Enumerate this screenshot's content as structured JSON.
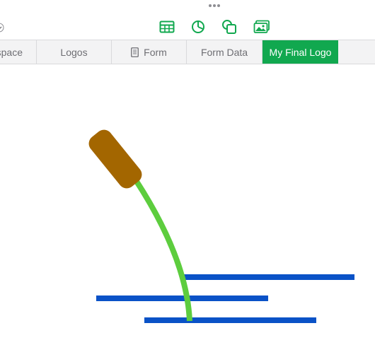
{
  "toolbar": {
    "icons": [
      "more-dots-icon",
      "table-icon",
      "chart-icon",
      "shape-icon",
      "media-icon"
    ],
    "accent_color": "#11a84f"
  },
  "tabs": [
    {
      "label": "space",
      "active": false
    },
    {
      "label": "Logos",
      "active": false
    },
    {
      "label": "Form",
      "active": false,
      "icon": "document-icon"
    },
    {
      "label": "Form Data",
      "active": false
    },
    {
      "label": "My Final Logo",
      "active": true
    }
  ],
  "canvas": {
    "colors": {
      "cattail_head": "#a36600",
      "stem": "#5dcd3e",
      "water_lines": "#0a52c7"
    }
  }
}
